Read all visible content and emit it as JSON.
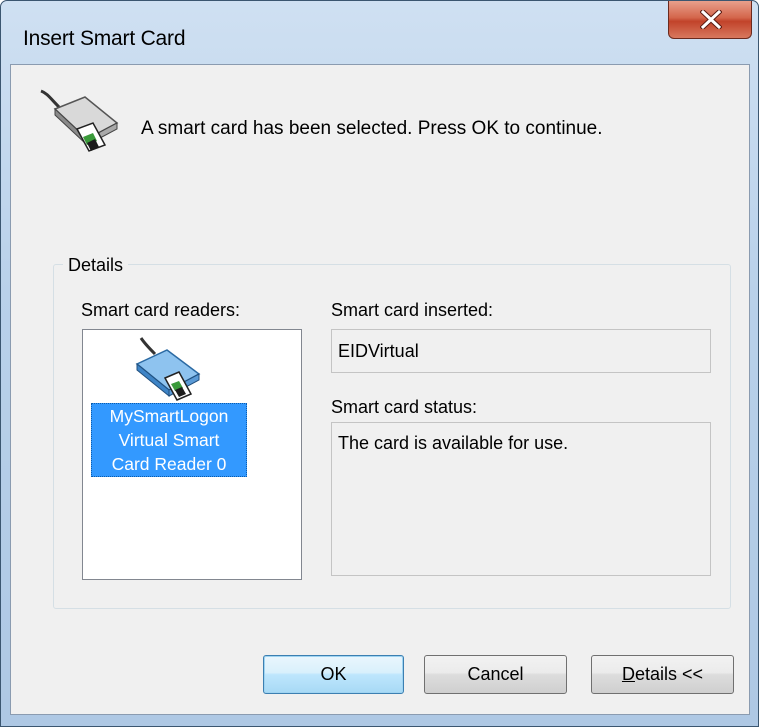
{
  "window": {
    "title": "Insert Smart Card",
    "close_icon": "close-x-icon"
  },
  "header": {
    "icon": "smart-card-reader-icon",
    "message": "A smart card has been selected.  Press OK to continue."
  },
  "details": {
    "group_label": "Details",
    "readers_label": "Smart card readers:",
    "readers": [
      {
        "icon": "smart-card-reader-icon",
        "name_line1": "MySmartLogon",
        "name_line2": "Virtual Smart",
        "name_line3": "Card Reader 0",
        "selected": true
      }
    ],
    "inserted_label": "Smart card inserted:",
    "inserted_value": "EIDVirtual",
    "status_label": "Smart card status:",
    "status_value": "The card is available for use."
  },
  "buttons": {
    "ok_label": "OK",
    "cancel_label": "Cancel",
    "details_prefix": "D",
    "details_rest": "etails <<"
  },
  "colors": {
    "selection": "#3399ff",
    "close_button": "#c1432a",
    "dialog_face": "#f0f0f0"
  }
}
